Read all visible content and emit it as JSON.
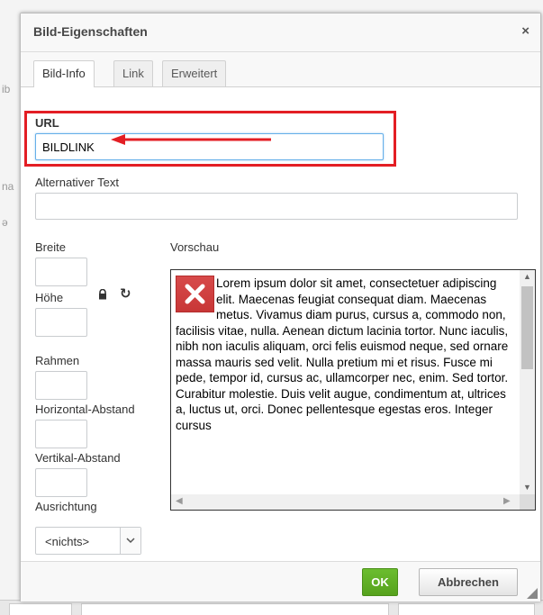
{
  "dialog": {
    "title": "Bild-Eigenschaften",
    "close_symbol": "×"
  },
  "tabs": [
    {
      "label": "Bild-Info",
      "active": true
    },
    {
      "label": "Link",
      "active": false
    },
    {
      "label": "Erweitert",
      "active": false
    }
  ],
  "form": {
    "url_label": "URL",
    "url_value": "BILDLINK",
    "alt_label": "Alternativer Text",
    "alt_value": "",
    "width_label": "Breite",
    "height_label": "Höhe",
    "border_label": "Rahmen",
    "hspace_label": "Horizontal-Abstand",
    "vspace_label": "Vertikal-Abstand",
    "align_label": "Ausrichtung",
    "align_value": "<nichts>",
    "preview_label": "Vorschau"
  },
  "icons": {
    "lock": "lock-icon",
    "reset": "reset-size-icon",
    "lock_symbol": "🔒",
    "reset_symbol": "↻"
  },
  "preview": {
    "text": "Lorem ipsum dolor sit amet, consectetuer adipiscing elit. Maecenas feugiat consequat diam. Maecenas metus. Vivamus diam purus, cursus a, commodo non, facilisis vitae, nulla. Aenean dictum lacinia tortor. Nunc iaculis, nibh non iaculis aliquam, orci felis euismod neque, sed ornare massa mauris sed velit. Nulla pretium mi et risus. Fusce mi pede, tempor id, cursus ac, ullamcorper nec, enim. Sed tortor. Curabitur molestie. Duis velit augue, condimentum at, ultrices a, luctus ut, orci. Donec pellentesque egestas eros. Integer cursus"
  },
  "buttons": {
    "ok": "OK",
    "cancel": "Abbrechen"
  },
  "colors": {
    "ok_green": "#56a21d",
    "highlight_red": "#e31e24"
  }
}
